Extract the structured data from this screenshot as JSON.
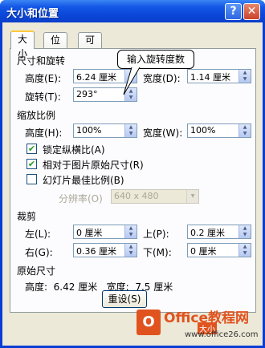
{
  "window": {
    "title": "大小和位置",
    "help": "?",
    "close": "✕"
  },
  "tabs": [
    "大小",
    "位置",
    "可选文字"
  ],
  "size_rotate": {
    "title": "尺寸和旋转",
    "height_label": "高度(E):",
    "height_value": "6.24 厘米",
    "width_label": "宽度(D):",
    "width_value": "1.14 厘米",
    "rotate_label": "旋转(T):",
    "rotate_value": "293°"
  },
  "callout": "输入旋转度数",
  "scale": {
    "title": "缩放比例",
    "height_label": "高度(H):",
    "height_value": "100%",
    "width_label": "宽度(W):",
    "width_value": "100%",
    "lock_ratio": "锁定纵横比(A)",
    "relative_original": "相对于图片原始尺寸(R)",
    "slideshow_best": "幻灯片最佳比例(B)",
    "resolution_label": "分辨率(O)",
    "resolution_value": "640 x 480"
  },
  "crop": {
    "title": "裁剪",
    "left_label": "左(L):",
    "left_value": "0 厘米",
    "top_label": "上(P):",
    "top_value": "0.2 厘米",
    "right_label": "右(G):",
    "right_value": "0.36 厘米",
    "bottom_label": "下(M):",
    "bottom_value": "0 厘米"
  },
  "original": {
    "title": "原始尺寸",
    "text": "高度:  6.42 厘米   宽度:  7.5 厘米"
  },
  "reset_button": "重设(S)",
  "watermark": {
    "logo": "O",
    "main": "Office教程网",
    "tag": "大小",
    "url": "www.office26.com"
  }
}
